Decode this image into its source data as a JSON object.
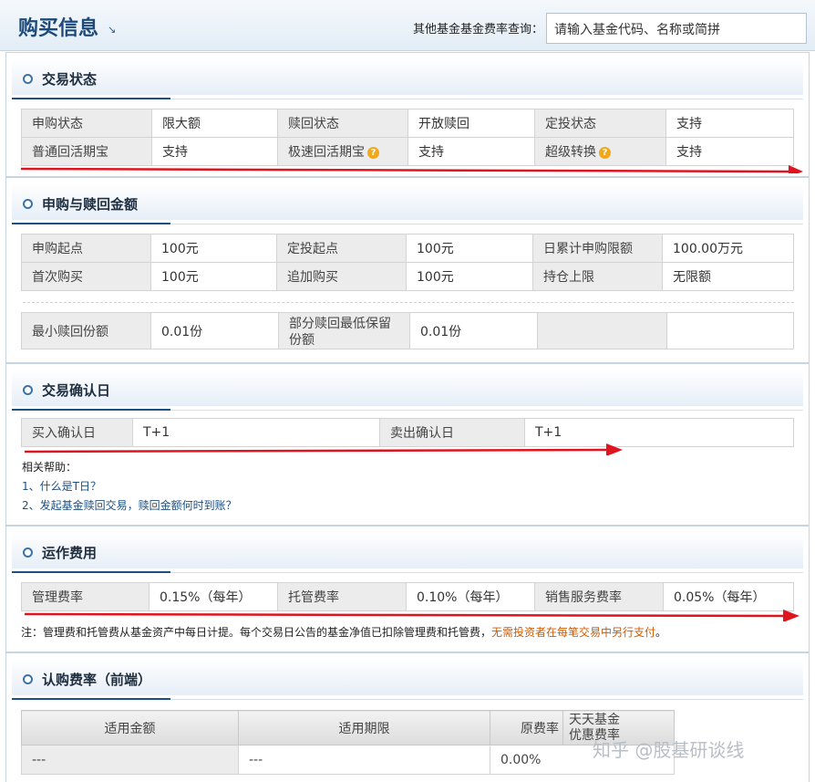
{
  "header": {
    "title": "购买信息",
    "search_label": "其他基金基金费率查询：",
    "search_placeholder": "请输入基金代码、名称或简拼"
  },
  "trade_status": {
    "title": "交易状态",
    "rows": [
      [
        {
          "k": "申购状态"
        },
        {
          "v": "限大额"
        },
        {
          "k": "赎回状态"
        },
        {
          "v": "开放赎回"
        },
        {
          "k": "定投状态"
        },
        {
          "v": "支持"
        }
      ],
      [
        {
          "k": "普通回活期宝"
        },
        {
          "v": "支持"
        },
        {
          "k": "极速回活期宝"
        },
        {
          "v": "支持"
        },
        {
          "k": "超级转换"
        },
        {
          "v": "支持"
        }
      ]
    ]
  },
  "amounts": {
    "title": "申购与赎回金额",
    "rows": [
      [
        "申购起点",
        "100元",
        "定投起点",
        "100元",
        "日累计申购限额",
        "100.00万元"
      ],
      [
        "首次购买",
        "100元",
        "追加购买",
        "100元",
        "持仓上限",
        "无限额"
      ]
    ],
    "redeem_row": [
      "最小赎回份额",
      "0.01份",
      "部分赎回最低保留份额",
      "0.01份",
      "",
      ""
    ]
  },
  "confirm": {
    "title": "交易确认日",
    "row": [
      "买入确认日",
      "T+1",
      "卖出确认日",
      "T+1"
    ],
    "help_title": "相关帮助：",
    "help_links": [
      "1、什么是T日？",
      "2、发起基金赎回交易，赎回金额何时到账？"
    ]
  },
  "fees": {
    "title": "运作费用",
    "row": [
      "管理费率",
      "0.15%（每年）",
      "托管费率",
      "0.10%（每年）",
      "销售服务费率",
      "0.05%（每年）"
    ],
    "note_prefix": "注：管理费和托管费从基金资产中每日计提。每个交易日公告的基金净值已扣除管理费和托管费，",
    "note_warn": "无需投资者在每笔交易中另行支付",
    "note_suffix": "。"
  },
  "subscription": {
    "title": "认购费率（前端）",
    "headers": [
      "适用金额",
      "适用期限",
      "原费率",
      "天天基金\n优惠费率"
    ],
    "row": [
      "---",
      "---",
      "0.00%"
    ]
  },
  "watermark": "知乎 @股基研谈线",
  "colors": {
    "arrow": "#e0141e",
    "accent": "#1c4f82",
    "warn": "#d05a00"
  }
}
